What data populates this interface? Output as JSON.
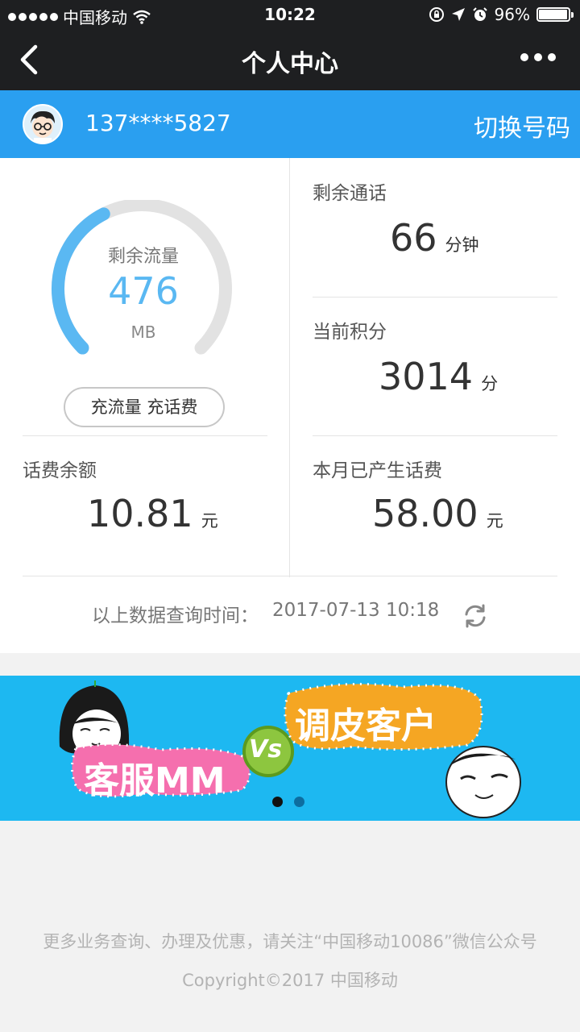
{
  "status_bar": {
    "carrier": "中国移动",
    "time": "10:22",
    "battery": "96%",
    "battery_level": 0.96
  },
  "nav": {
    "title": "个人中心"
  },
  "user": {
    "phone": "137****5827",
    "switch_label": "切换号码"
  },
  "data_usage": {
    "label": "剩余流量",
    "value": "476",
    "unit": "MB",
    "remaining_fraction": 0.4,
    "recharge_label": "充流量 充话费"
  },
  "call_minutes": {
    "label": "剩余通话",
    "value": "66",
    "unit": "分钟"
  },
  "points": {
    "label": "当前积分",
    "value": "3014",
    "unit": "分"
  },
  "balance": {
    "label": "话费余额",
    "value": "10.81",
    "unit": "元"
  },
  "monthly_fee": {
    "label": "本月已产生话费",
    "value": "58.00",
    "unit": "元"
  },
  "query": {
    "label": "以上数据查询时间：",
    "time": "2017-07-13 10:18"
  },
  "banner": {
    "left_caption": "客服MM",
    "versus": "Vs",
    "right_caption": "调皮客户",
    "slide_count": 2,
    "active_slide": 1
  },
  "footer": {
    "note": "更多业务查询、办理及优惠，请关注“中国移动10086”微信公众号",
    "copyright": "Copyright©2017 中国移动"
  },
  "colors": {
    "accent_blue": "#2a9ff0",
    "gauge_blue": "#5ab8f2",
    "dark_bar": "#1e1f21",
    "banner_bg": "#1db8f1"
  }
}
